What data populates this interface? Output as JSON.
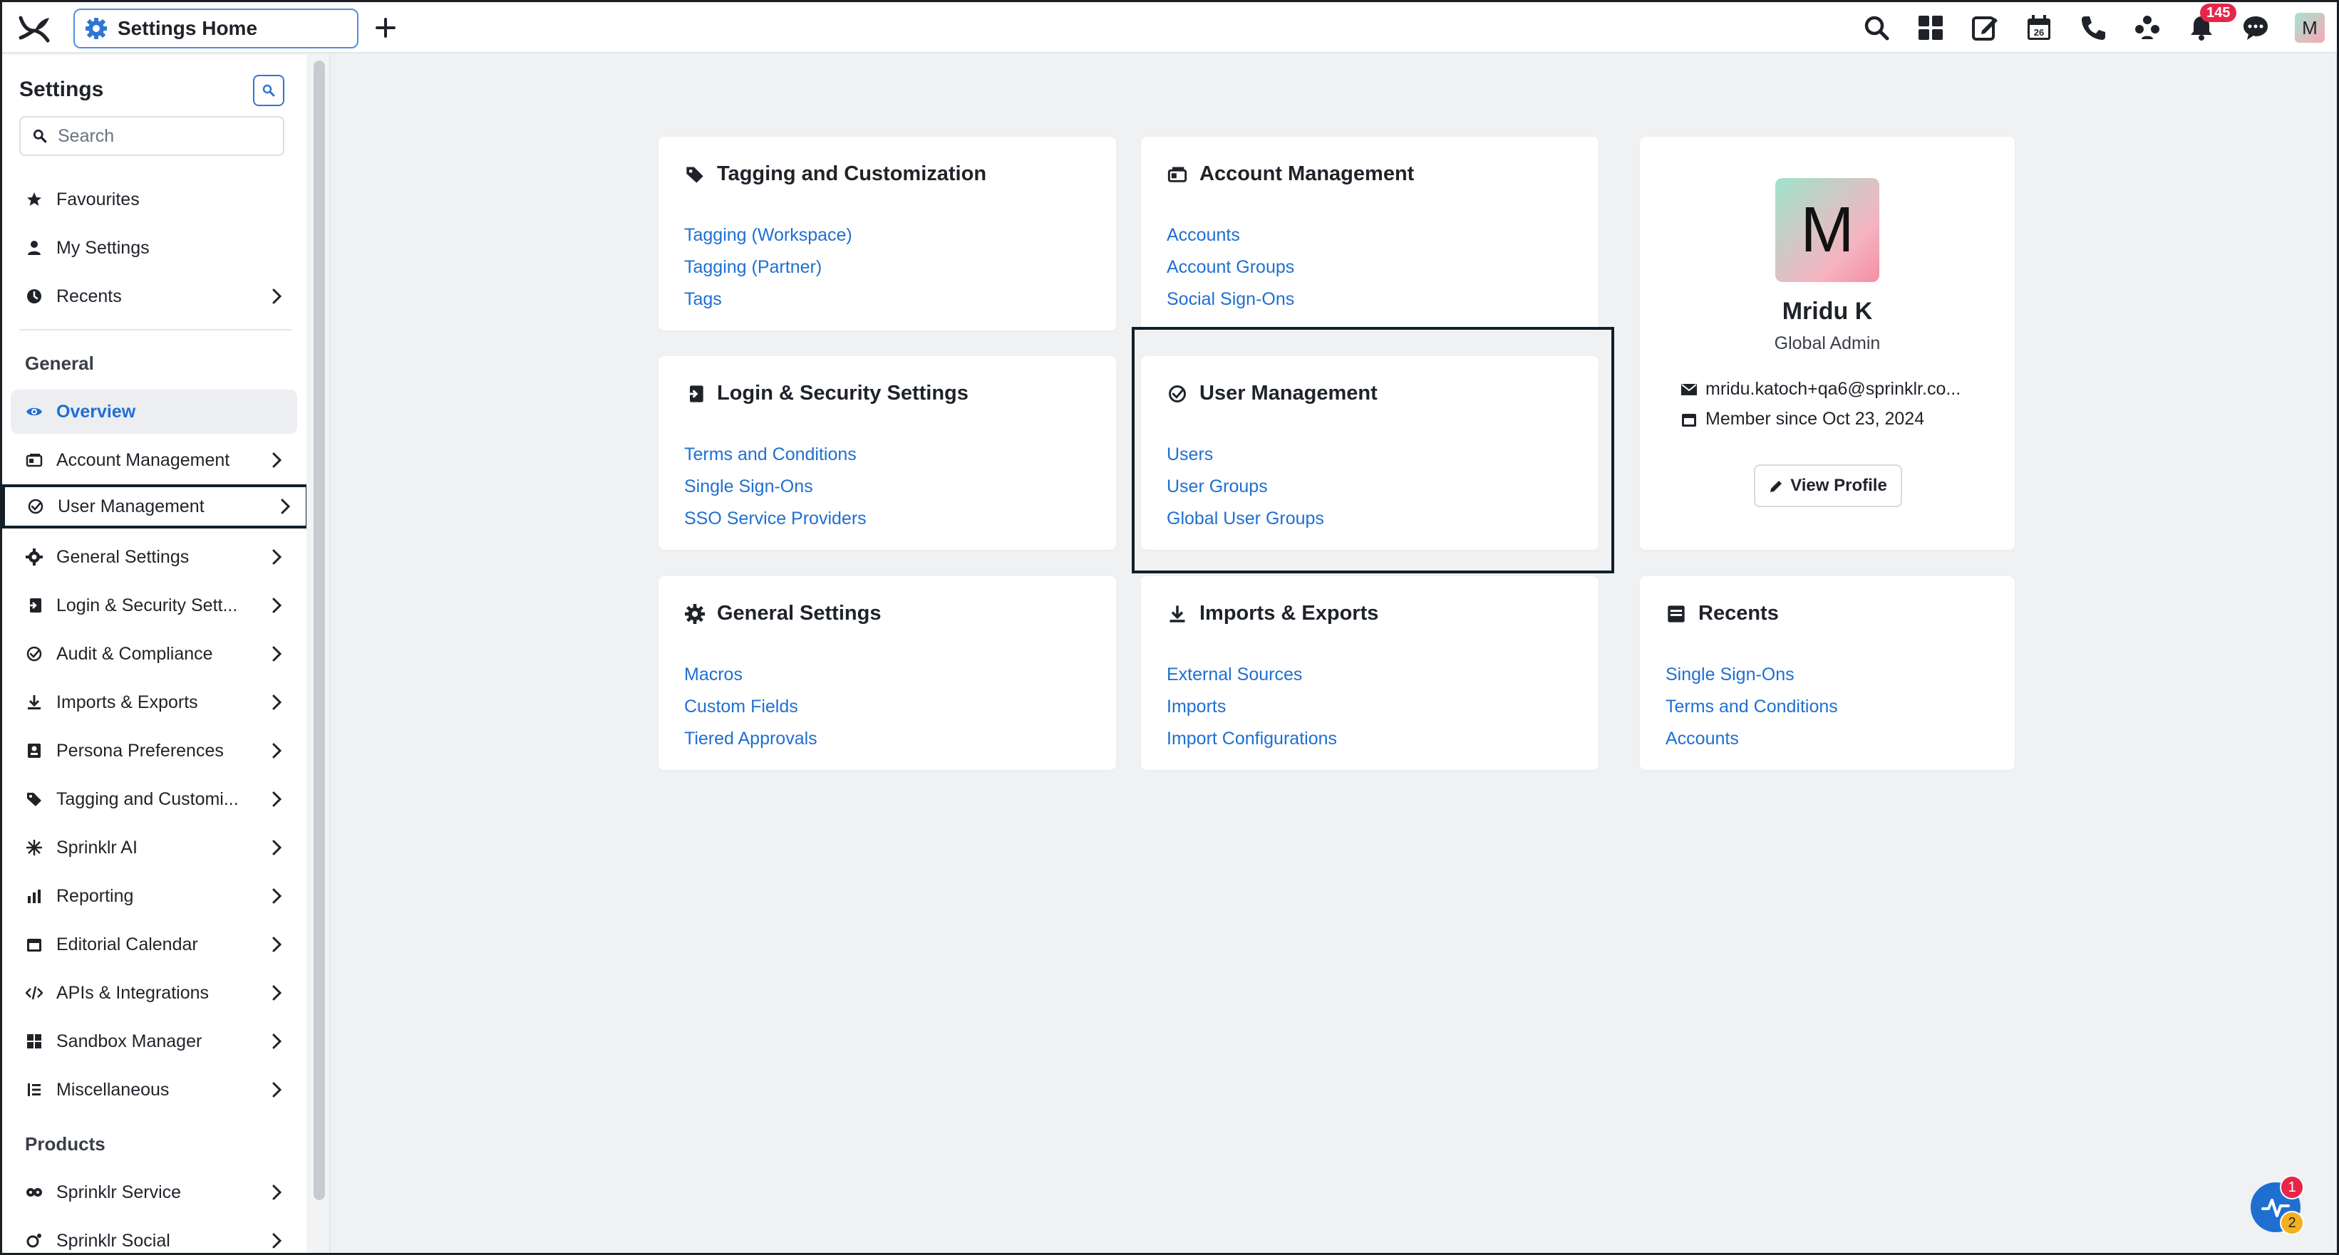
{
  "topbar": {
    "tab_label": "Settings Home",
    "notifications_count": "145",
    "avatar_initial": "M"
  },
  "sidebar": {
    "title": "Settings",
    "search_placeholder": "Search",
    "quick": [
      {
        "label": "Favourites",
        "icon": "star-icon"
      },
      {
        "label": "My Settings",
        "icon": "user-icon"
      },
      {
        "label": "Recents",
        "icon": "clock-icon"
      }
    ],
    "general_heading": "General",
    "general": [
      {
        "label": "Overview",
        "icon": "eye-icon"
      },
      {
        "label": "Account Management",
        "icon": "id-card-icon"
      },
      {
        "label": "User Management",
        "icon": "check-circle-icon"
      },
      {
        "label": "General Settings",
        "icon": "gear-icon"
      },
      {
        "label": "Login & Security Sett...",
        "icon": "login-icon"
      },
      {
        "label": "Audit & Compliance",
        "icon": "check-circle-icon"
      },
      {
        "label": "Imports & Exports",
        "icon": "download-icon"
      },
      {
        "label": "Persona Preferences",
        "icon": "persona-icon"
      },
      {
        "label": "Tagging and Customi...",
        "icon": "tag-icon"
      },
      {
        "label": "Sprinklr AI",
        "icon": "sparkle-icon"
      },
      {
        "label": "Reporting",
        "icon": "bar-chart-icon"
      },
      {
        "label": "Editorial Calendar",
        "icon": "calendar-icon"
      },
      {
        "label": "APIs & Integrations",
        "icon": "code-icon"
      },
      {
        "label": "Sandbox Manager",
        "icon": "grid-icon"
      },
      {
        "label": "Miscellaneous",
        "icon": "list-icon"
      }
    ],
    "products_heading": "Products",
    "products": [
      {
        "label": "Sprinklr Service",
        "icon": "service-icon"
      },
      {
        "label": "Sprinklr Social",
        "icon": "social-icon"
      }
    ]
  },
  "cards": {
    "tagging": {
      "title": "Tagging and Customization",
      "links": [
        "Tagging (Workspace)",
        "Tagging (Partner)",
        "Tags"
      ]
    },
    "account": {
      "title": "Account Management",
      "links": [
        "Accounts",
        "Account Groups",
        "Social Sign-Ons"
      ]
    },
    "login": {
      "title": "Login & Security Settings",
      "links": [
        "Terms and Conditions",
        "Single Sign-Ons",
        "SSO Service Providers"
      ]
    },
    "user": {
      "title": "User Management",
      "links": [
        "Users",
        "User Groups",
        "Global User Groups"
      ]
    },
    "general": {
      "title": "General Settings",
      "links": [
        "Macros",
        "Custom Fields",
        "Tiered Approvals"
      ]
    },
    "imports": {
      "title": "Imports & Exports",
      "links": [
        "External Sources",
        "Imports",
        "Import Configurations"
      ]
    },
    "recents": {
      "title": "Recents",
      "links": [
        "Single Sign-Ons",
        "Terms and Conditions",
        "Accounts"
      ]
    }
  },
  "profile": {
    "initial": "M",
    "name": "Mridu K",
    "role": "Global Admin",
    "email": "mridu.katoch+qa6@sprinklr.co...",
    "member_since": "Member since Oct 23, 2024",
    "view_label": "View Profile"
  },
  "widget": {
    "badge_red": "1",
    "badge_yellow": "2"
  },
  "colors": {
    "accent": "#1f6fd1",
    "badge": "#e5264a"
  }
}
